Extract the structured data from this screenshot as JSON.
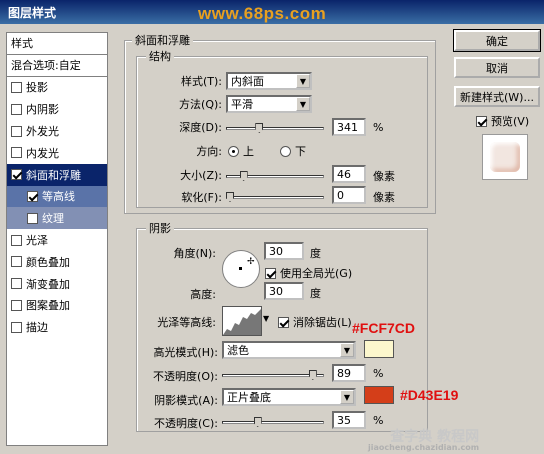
{
  "window": {
    "title": "图层样式"
  },
  "watermark": {
    "top": "www.68ps.com",
    "bottom": "查字典 教程网",
    "bottom_sub": "jiaocheng.chazidian.com"
  },
  "sidebar": {
    "header": "样式",
    "blend": "混合选项:自定",
    "items": [
      {
        "label": "投影",
        "checked": false
      },
      {
        "label": "内阴影",
        "checked": false
      },
      {
        "label": "外发光",
        "checked": false
      },
      {
        "label": "内发光",
        "checked": false
      },
      {
        "label": "斜面和浮雕",
        "checked": true
      },
      {
        "label": "等高线",
        "checked": true
      },
      {
        "label": "纹理",
        "checked": false
      },
      {
        "label": "光泽",
        "checked": false
      },
      {
        "label": "颜色叠加",
        "checked": false
      },
      {
        "label": "渐变叠加",
        "checked": false
      },
      {
        "label": "图案叠加",
        "checked": false
      },
      {
        "label": "描边",
        "checked": false
      }
    ]
  },
  "bevel": {
    "title": "斜面和浮雕",
    "structure_title": "结构",
    "style_label": "样式(T):",
    "style_value": "内斜面",
    "method_label": "方法(Q):",
    "method_value": "平滑",
    "depth_label": "深度(D):",
    "depth_value": "341",
    "depth_unit": "%",
    "depth_level": 0.34,
    "direction_label": "方向:",
    "dir_up": "上",
    "dir_down": "下",
    "size_label": "大小(Z):",
    "size_value": "46",
    "size_unit": "像素",
    "size_level": 0.18,
    "soften_label": "软化(F):",
    "soften_value": "0",
    "soften_unit": "像素",
    "soften_level": 0
  },
  "shading": {
    "title": "阴影",
    "angle_label": "角度(N):",
    "angle_value": "30",
    "angle_unit": "度",
    "global_light": "使用全局光(G)",
    "altitude_label": "高度:",
    "altitude_value": "30",
    "altitude_unit": "度",
    "gloss_label": "光泽等高线:",
    "antialias": "消除锯齿(L)",
    "highlight_label": "高光模式(H):",
    "highlight_value": "滤色",
    "highlight_color": "#FCF7CD",
    "hl_opacity_label": "不透明度(O):",
    "hl_opacity_value": "89",
    "hl_opacity_level": 0.89,
    "shadow_label": "阴影模式(A):",
    "shadow_value": "正片叠底",
    "shadow_color": "#D43E19",
    "sh_opacity_label": "不透明度(C):",
    "sh_opacity_value": "35",
    "sh_opacity_level": 0.35,
    "pct": "%"
  },
  "annotations": {
    "highlight": "#FCF7CD",
    "shadow": "#D43E19"
  },
  "buttons": {
    "ok": "确定",
    "cancel": "取消",
    "new_style": "新建样式(W)...",
    "preview": "预览(V)"
  }
}
